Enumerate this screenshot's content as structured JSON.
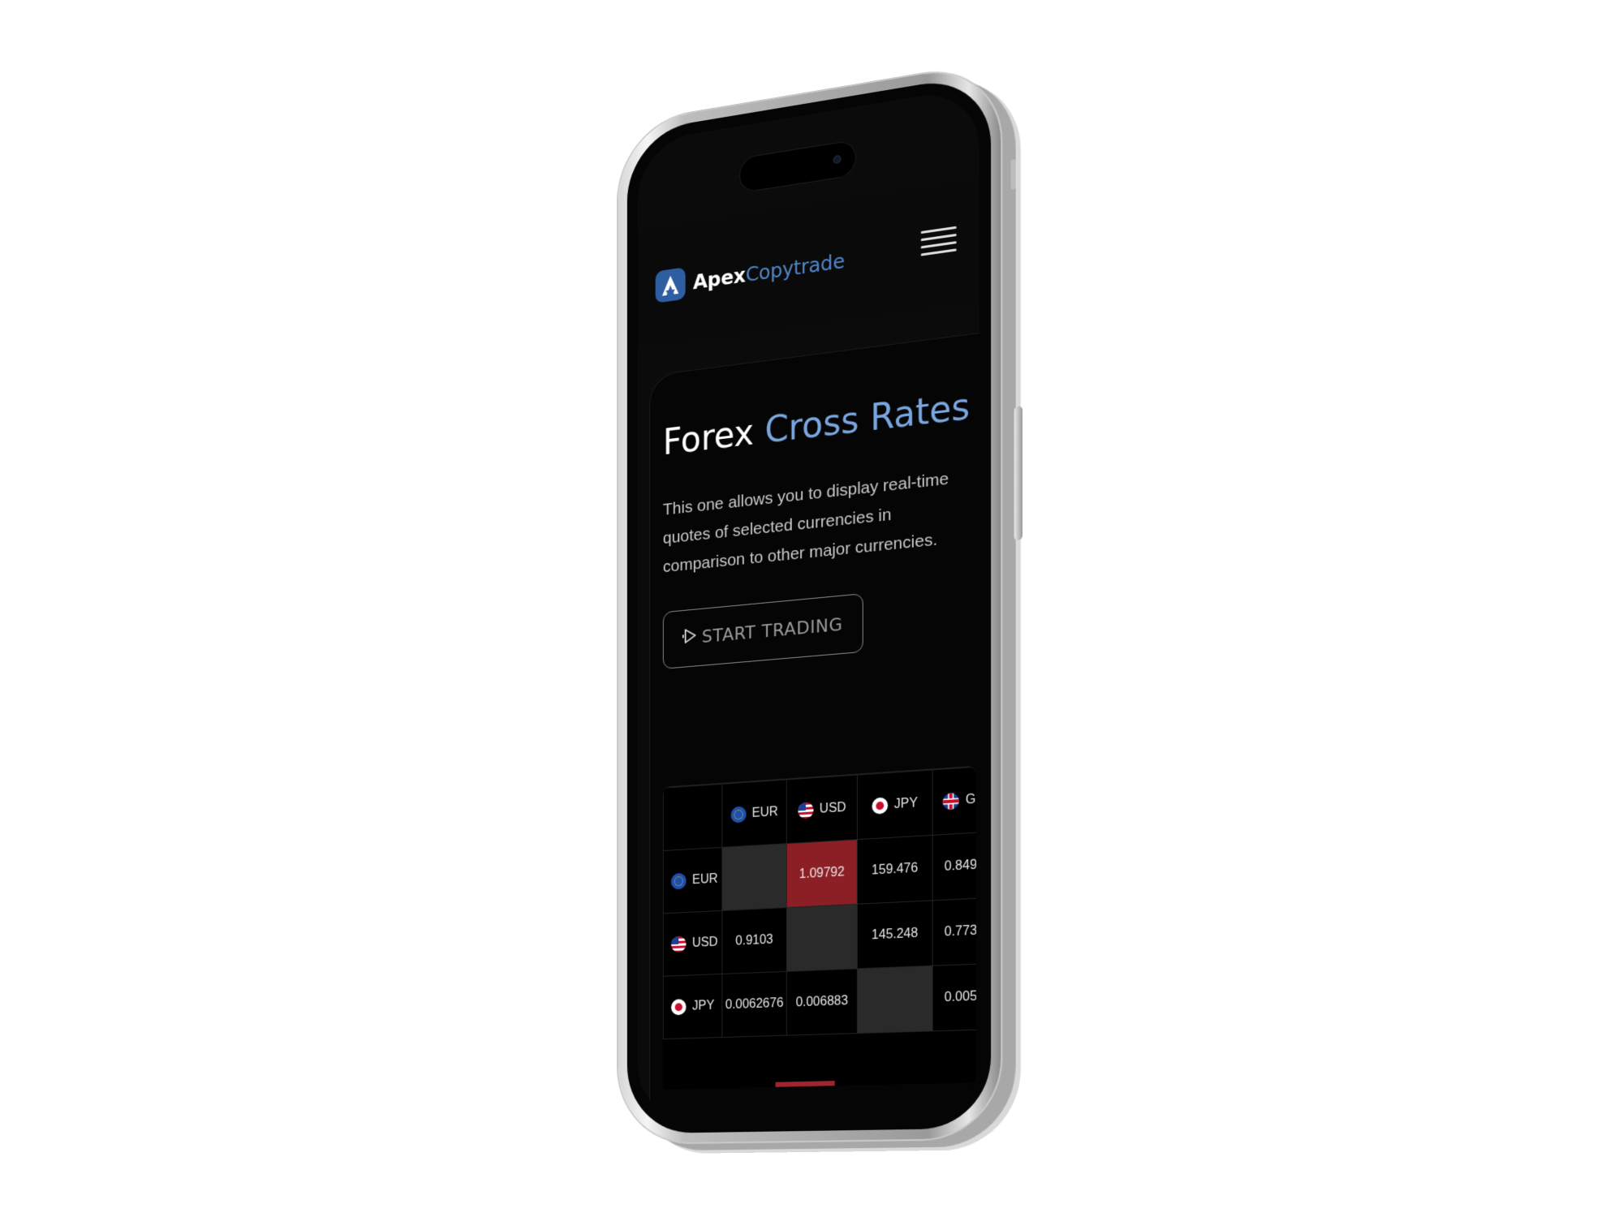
{
  "header": {
    "brand_part1": "Apex",
    "brand_part2": "Copytrade"
  },
  "hero": {
    "title_part1": "Forex",
    "title_part2": "Cross Rates",
    "description": "This one allows you to display real-time quotes of selected currencies in comparison to other major currencies.",
    "cta_label": "START TRADING"
  },
  "rates_table": {
    "columns": [
      "EUR",
      "USD",
      "JPY",
      "G"
    ],
    "rows": [
      {
        "label": "EUR",
        "cells": [
          "",
          "1.09792",
          "159.476",
          "0.849"
        ]
      },
      {
        "label": "USD",
        "cells": [
          "0.9103",
          "",
          "145.248",
          "0.773"
        ]
      },
      {
        "label": "JPY",
        "cells": [
          "0.0062676",
          "0.006883",
          "",
          "0.005"
        ]
      }
    ]
  },
  "colors": {
    "brand_blue": "#4f86c9",
    "title_accent": "#79a6df",
    "negative_cell": "#8c1f25",
    "screen_bg": "#050505"
  },
  "icons": [
    "logo-mark-icon",
    "menu-icon",
    "play-icon",
    "eur-flag-icon",
    "usd-flag-icon",
    "jpy-flag-icon",
    "gbp-flag-icon"
  ]
}
